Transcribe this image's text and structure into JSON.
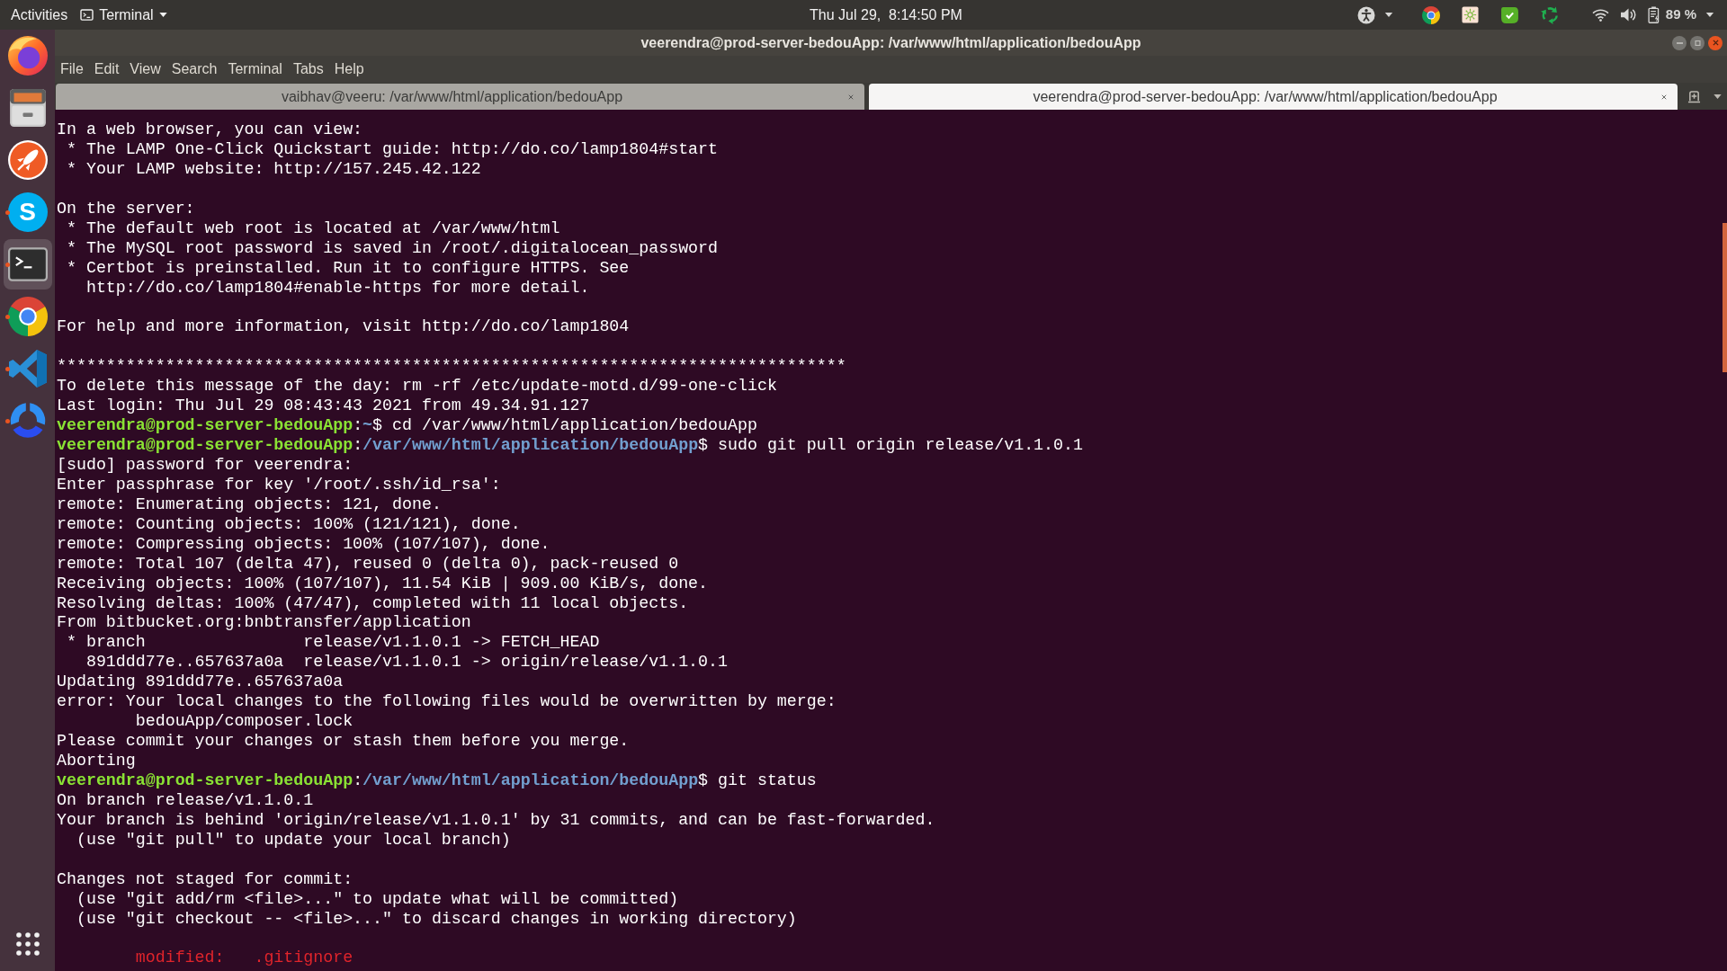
{
  "top_bar": {
    "activities": "Activities",
    "app_menu": "Terminal",
    "clock": "Thu Jul 29,  8:14:50 PM",
    "battery": "89 %"
  },
  "dock": [
    {
      "kind": "globe",
      "running": false,
      "selected": false
    },
    {
      "kind": "drawer",
      "running": false,
      "selected": false
    },
    {
      "kind": "rocket",
      "running": false,
      "selected": false
    },
    {
      "kind": "letter",
      "glyph": "S",
      "running": true,
      "selected": false
    },
    {
      "kind": "terminal",
      "running": true,
      "selected": true
    },
    {
      "kind": "wheel",
      "running": true,
      "selected": false
    },
    {
      "kind": "ribbon",
      "running": true,
      "selected": false
    },
    {
      "kind": "ring",
      "running": true,
      "selected": false
    }
  ],
  "window": {
    "title": "veerendra@prod-server-bedouApp: /var/www/html/application/bedouApp"
  },
  "menu": [
    "File",
    "Edit",
    "View",
    "Search",
    "Terminal",
    "Tabs",
    "Help"
  ],
  "tabs": [
    {
      "title": "vaibhav@veeru: /var/www/html/application/bedouApp",
      "selected": false
    },
    {
      "title": "veerendra@prod-server-bedouApp: /var/www/html/application/bedouApp",
      "selected": true
    }
  ],
  "terminal": {
    "lines": [
      {
        "kind": "output",
        "text": "In a web browser, you can view:"
      },
      {
        "kind": "output",
        "text": " * The LAMP One-Click Quickstart guide: http://do.co/lamp1804#start"
      },
      {
        "kind": "output",
        "text": " * Your LAMP website: http://157.245.42.122"
      },
      {
        "kind": "blank"
      },
      {
        "kind": "output",
        "text": "On the server:"
      },
      {
        "kind": "output",
        "text": " * The default web root is located at /var/www/html"
      },
      {
        "kind": "output",
        "text": " * The MySQL root password is saved in /root/.digitalocean_password"
      },
      {
        "kind": "output",
        "text": " * Certbot is preinstalled. Run it to configure HTTPS. See"
      },
      {
        "kind": "output",
        "text": "   http://do.co/lamp1804#enable-https for more detail."
      },
      {
        "kind": "blank"
      },
      {
        "kind": "output",
        "text": "For help and more information, visit http://do.co/lamp1804"
      },
      {
        "kind": "blank"
      },
      {
        "kind": "output",
        "text": "********************************************************************************"
      },
      {
        "kind": "output",
        "text": "To delete this message of the day: rm -rf /etc/update-motd.d/99-one-click"
      },
      {
        "kind": "output",
        "text": "Last login: Thu Jul 29 08:43:43 2021 from 49.34.91.127"
      },
      {
        "kind": "prompt",
        "parts": [
          {
            "kind": "user",
            "text": "veerendra@prod-server-bedouApp"
          },
          {
            "kind": "plain",
            "text": ":"
          },
          {
            "kind": "path",
            "text": "~"
          },
          {
            "kind": "plain",
            "text": "$ cd /var/www/html/application/bedouApp"
          }
        ]
      },
      {
        "kind": "prompt",
        "parts": [
          {
            "kind": "user",
            "text": "veerendra@prod-server-bedouApp"
          },
          {
            "kind": "plain",
            "text": ":"
          },
          {
            "kind": "path",
            "text": "/var/www/html/application/bedouApp"
          },
          {
            "kind": "plain",
            "text": "$ sudo git pull origin release/v1.1.0.1"
          }
        ]
      },
      {
        "kind": "output",
        "text": "[sudo] password for veerendra:"
      },
      {
        "kind": "output",
        "text": "Enter passphrase for key '/root/.ssh/id_rsa':"
      },
      {
        "kind": "output",
        "text": "remote: Enumerating objects: 121, done."
      },
      {
        "kind": "output",
        "text": "remote: Counting objects: 100% (121/121), done."
      },
      {
        "kind": "output",
        "text": "remote: Compressing objects: 100% (107/107), done."
      },
      {
        "kind": "output",
        "text": "remote: Total 107 (delta 47), reused 0 (delta 0), pack-reused 0"
      },
      {
        "kind": "output",
        "text": "Receiving objects: 100% (107/107), 11.54 KiB | 909.00 KiB/s, done."
      },
      {
        "kind": "output",
        "text": "Resolving deltas: 100% (47/47), completed with 11 local objects."
      },
      {
        "kind": "output",
        "text": "From bitbucket.org:bnbtransfer/application"
      },
      {
        "kind": "output",
        "text": " * branch                release/v1.1.0.1 -> FETCH_HEAD"
      },
      {
        "kind": "output",
        "text": "   891ddd77e..657637a0a  release/v1.1.0.1 -> origin/release/v1.1.0.1"
      },
      {
        "kind": "output",
        "text": "Updating 891ddd77e..657637a0a"
      },
      {
        "kind": "output",
        "text": "error: Your local changes to the following files would be overwritten by merge:"
      },
      {
        "kind": "output",
        "text": "        bedouApp/composer.lock"
      },
      {
        "kind": "output",
        "text": "Please commit your changes or stash them before you merge."
      },
      {
        "kind": "output",
        "text": "Aborting"
      },
      {
        "kind": "prompt",
        "parts": [
          {
            "kind": "user",
            "text": "veerendra@prod-server-bedouApp"
          },
          {
            "kind": "plain",
            "text": ":"
          },
          {
            "kind": "path",
            "text": "/var/www/html/application/bedouApp"
          },
          {
            "kind": "plain",
            "text": "$ git status"
          }
        ]
      },
      {
        "kind": "output",
        "text": "On branch release/v1.1.0.1"
      },
      {
        "kind": "output",
        "text": "Your branch is behind 'origin/release/v1.1.0.1' by 31 commits, and can be fast-forwarded."
      },
      {
        "kind": "output",
        "text": "  (use \"git pull\" to update your local branch)"
      },
      {
        "kind": "blank"
      },
      {
        "kind": "output",
        "text": "Changes not staged for commit:"
      },
      {
        "kind": "output",
        "text": "  (use \"git add/rm <file>...\" to update what will be committed)"
      },
      {
        "kind": "output",
        "text": "  (use \"git checkout -- <file>...\" to discard changes in working directory)"
      },
      {
        "kind": "blank"
      },
      {
        "kind": "changed",
        "text": "        modified:   .gitignore"
      }
    ]
  }
}
